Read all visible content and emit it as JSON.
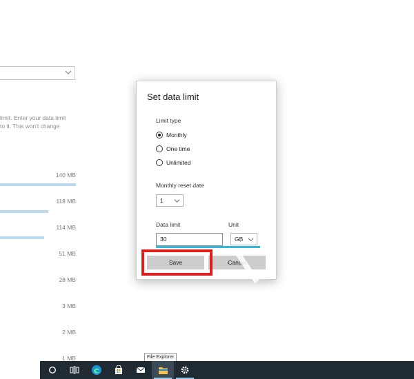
{
  "background": {
    "description_lines": [
      "limit. Enter your data limit",
      "to it. This won't change"
    ],
    "usage_items": [
      {
        "label": "140 MB",
        "fraction": 1.0
      },
      {
        "label": "118 MB",
        "fraction": 0.64
      },
      {
        "label": "114 MB",
        "fraction": 0.58
      },
      {
        "label": "51 MB",
        "fraction": null
      },
      {
        "label": "28 MB",
        "fraction": null
      },
      {
        "label": "3 MB",
        "fraction": null
      },
      {
        "label": "2 MB",
        "fraction": null
      },
      {
        "label": "1 MB",
        "fraction": null
      }
    ]
  },
  "dialog": {
    "title": "Set data limit",
    "limit_type_label": "Limit type",
    "limit_options": [
      "Monthly",
      "One time",
      "Unlimited"
    ],
    "selected_limit_type": "Monthly",
    "reset_date_label": "Monthly reset date",
    "reset_date_value": "1",
    "data_limit_label": "Data limit",
    "data_limit_value": "30",
    "unit_label": "Unit",
    "unit_value": "GB",
    "save_label": "Save",
    "cancel_label": "Cancel"
  },
  "taskbar": {
    "tooltip": "File Explorer",
    "icons": [
      "search-circle-icon",
      "task-view-icon",
      "edge-icon",
      "store-icon",
      "mail-icon",
      "file-explorer-icon",
      "settings-icon"
    ]
  },
  "colors": {
    "accent": "#35b7d9",
    "usage_bar": "#b9d9ef",
    "highlight": "#e01e1e",
    "taskbar": "#1f2a33"
  }
}
